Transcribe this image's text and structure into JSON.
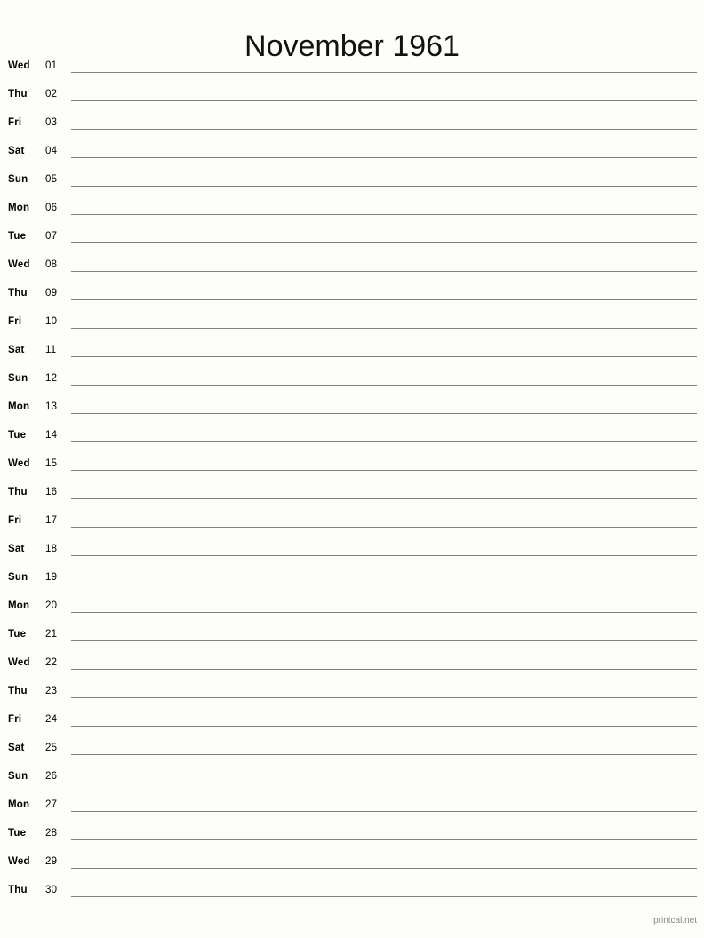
{
  "page": {
    "title": "November 1961",
    "background_color": "#fdfdfa",
    "rule_color": "#808080",
    "text_color": "#000000"
  },
  "footer": {
    "credit": "printcal.net",
    "color": "#888888"
  },
  "calendar": {
    "month": "November",
    "year": "1961",
    "days_in_month": 30,
    "first_weekday": "Wed",
    "rows": [
      {
        "weekday": "Wed",
        "number": "01"
      },
      {
        "weekday": "Thu",
        "number": "02"
      },
      {
        "weekday": "Fri",
        "number": "03"
      },
      {
        "weekday": "Sat",
        "number": "04"
      },
      {
        "weekday": "Sun",
        "number": "05"
      },
      {
        "weekday": "Mon",
        "number": "06"
      },
      {
        "weekday": "Tue",
        "number": "07"
      },
      {
        "weekday": "Wed",
        "number": "08"
      },
      {
        "weekday": "Thu",
        "number": "09"
      },
      {
        "weekday": "Fri",
        "number": "10"
      },
      {
        "weekday": "Sat",
        "number": "11"
      },
      {
        "weekday": "Sun",
        "number": "12"
      },
      {
        "weekday": "Mon",
        "number": "13"
      },
      {
        "weekday": "Tue",
        "number": "14"
      },
      {
        "weekday": "Wed",
        "number": "15"
      },
      {
        "weekday": "Thu",
        "number": "16"
      },
      {
        "weekday": "Fri",
        "number": "17"
      },
      {
        "weekday": "Sat",
        "number": "18"
      },
      {
        "weekday": "Sun",
        "number": "19"
      },
      {
        "weekday": "Mon",
        "number": "20"
      },
      {
        "weekday": "Tue",
        "number": "21"
      },
      {
        "weekday": "Wed",
        "number": "22"
      },
      {
        "weekday": "Thu",
        "number": "23"
      },
      {
        "weekday": "Fri",
        "number": "24"
      },
      {
        "weekday": "Sat",
        "number": "25"
      },
      {
        "weekday": "Sun",
        "number": "26"
      },
      {
        "weekday": "Mon",
        "number": "27"
      },
      {
        "weekday": "Tue",
        "number": "28"
      },
      {
        "weekday": "Wed",
        "number": "29"
      },
      {
        "weekday": "Thu",
        "number": "30"
      }
    ]
  }
}
